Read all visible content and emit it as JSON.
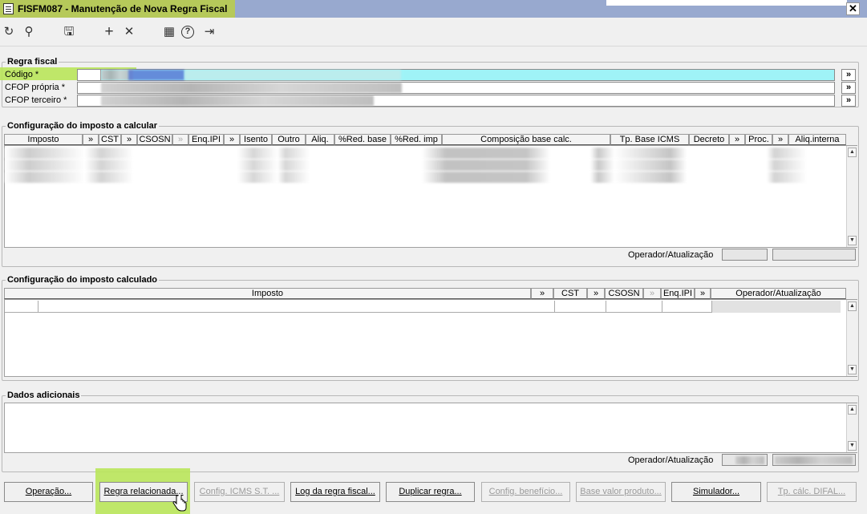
{
  "window": {
    "title": "FISFM087 - Manutenção de Nova Regra Fiscal",
    "close_glyph": "✕"
  },
  "toolbar": {
    "items": [
      {
        "name": "refresh-icon",
        "glyph": "↻"
      },
      {
        "name": "search-icon",
        "glyph": "⚲"
      },
      {
        "name": "save-icon",
        "glyph": "🖫"
      },
      {
        "name": "add-icon",
        "glyph": "+"
      },
      {
        "name": "delete-icon",
        "glyph": "✕"
      },
      {
        "name": "calendar-icon",
        "glyph": "▦"
      },
      {
        "name": "help-icon",
        "glyph": "?"
      },
      {
        "name": "exit-icon",
        "glyph": "⇥"
      }
    ]
  },
  "regra_fiscal": {
    "legend": "Regra fiscal",
    "codigo_label": "Código *",
    "cfop_propria_label": "CFOP própria *",
    "cfop_terceiro_label": "CFOP terceiro *",
    "lookup_glyph": "»"
  },
  "imposto_a_calcular": {
    "legend": "Configuração do imposto a calcular",
    "columns": [
      "Imposto",
      "»",
      "CST",
      "»",
      "CSOSN",
      "»",
      "Enq.IPI",
      "»",
      "Isento",
      "Outro",
      "Aliq.",
      "%Red. base",
      "%Red. imp",
      "Composição base calc.",
      "Tp. Base ICMS",
      "Decreto",
      "»",
      "Proc.",
      "»",
      "Aliq.interna"
    ],
    "operador_label": "Operador/Atualização"
  },
  "imposto_calculado": {
    "legend": "Configuração do imposto calculado",
    "columns": [
      "Imposto",
      "»",
      "CST",
      "»",
      "CSOSN",
      "»",
      "Enq.IPI",
      "»",
      "Operador/Atualização"
    ]
  },
  "dados_adicionais": {
    "legend": "Dados adicionais",
    "operador_label": "Operador/Atualização"
  },
  "buttons": [
    {
      "label": "Operação...",
      "enabled": true
    },
    {
      "label": "Regra relacionada...",
      "enabled": true
    },
    {
      "label": "Config. ICMS S.T. ...",
      "enabled": false
    },
    {
      "label": "Log da regra fiscal...",
      "enabled": true
    },
    {
      "label": "Duplicar regra...",
      "enabled": true
    },
    {
      "label": "Config. benefício...",
      "enabled": false
    },
    {
      "label": "Base valor produto...",
      "enabled": false
    },
    {
      "label": "Simulador...",
      "enabled": true
    },
    {
      "label": "Tp. cálc. DIFAL...",
      "enabled": false
    }
  ],
  "scroll": {
    "up_glyph": "▲",
    "down_glyph": "▼"
  },
  "colors": {
    "titlebar": "#98a9cf",
    "highlight": "#b9e65a",
    "cyan_field": "#9ff3f7"
  }
}
